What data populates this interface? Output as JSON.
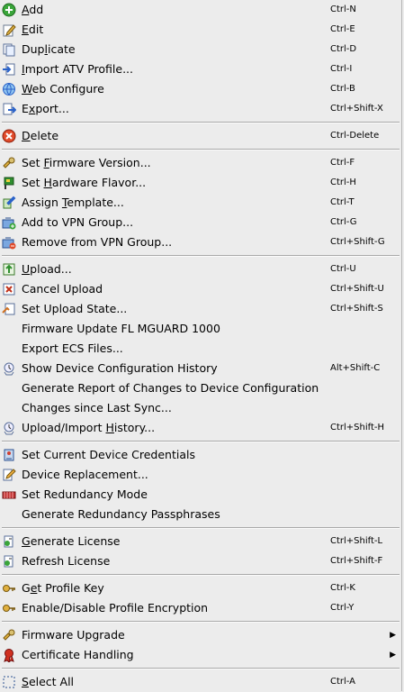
{
  "menu": {
    "groups": [
      [
        {
          "id": "add",
          "label": "Add",
          "mnemonic": 0,
          "shortcut": "Ctrl-N",
          "icon": "add-icon"
        },
        {
          "id": "edit",
          "label": "Edit",
          "mnemonic": 0,
          "shortcut": "Ctrl-E",
          "icon": "edit-icon"
        },
        {
          "id": "duplicate",
          "label": "Duplicate",
          "mnemonic": 3,
          "shortcut": "Ctrl-D",
          "icon": "duplicate-icon"
        },
        {
          "id": "import-atv-profile",
          "label": "Import ATV Profile...",
          "mnemonic": 0,
          "shortcut": "Ctrl-I",
          "icon": "import-icon"
        },
        {
          "id": "web-configure",
          "label": "Web Configure",
          "mnemonic": 0,
          "shortcut": "Ctrl-B",
          "icon": "globe-icon"
        },
        {
          "id": "export",
          "label": "Export...",
          "mnemonic": 1,
          "shortcut": "Ctrl+Shift-X",
          "icon": "export-icon"
        }
      ],
      [
        {
          "id": "delete",
          "label": "Delete",
          "mnemonic": 0,
          "shortcut": "Ctrl-Delete",
          "icon": "delete-icon"
        }
      ],
      [
        {
          "id": "set-firmware-version",
          "label": "Set Firmware Version...",
          "mnemonic": 4,
          "shortcut": "Ctrl-F",
          "icon": "firmware-icon"
        },
        {
          "id": "set-hardware-flavor",
          "label": "Set Hardware Flavor...",
          "mnemonic": 4,
          "shortcut": "Ctrl-H",
          "icon": "hardware-icon"
        },
        {
          "id": "assign-template",
          "label": "Assign Template...",
          "mnemonic": 7,
          "shortcut": "Ctrl-T",
          "icon": "template-icon"
        },
        {
          "id": "add-to-vpn-group",
          "label": "Add to VPN Group...",
          "mnemonic": -1,
          "shortcut": "Ctrl-G",
          "icon": "vpn-add-icon"
        },
        {
          "id": "remove-from-vpn-group",
          "label": "Remove from VPN Group...",
          "mnemonic": -1,
          "shortcut": "Ctrl+Shift-G",
          "icon": "vpn-remove-icon"
        }
      ],
      [
        {
          "id": "upload",
          "label": "Upload...",
          "mnemonic": 0,
          "shortcut": "Ctrl-U",
          "icon": "upload-icon"
        },
        {
          "id": "cancel-upload",
          "label": "Cancel Upload",
          "mnemonic": -1,
          "shortcut": "Ctrl+Shift-U",
          "icon": "cancel-upload-icon"
        },
        {
          "id": "set-upload-state",
          "label": "Set Upload State...",
          "mnemonic": -1,
          "shortcut": "Ctrl+Shift-S",
          "icon": "upload-state-icon"
        },
        {
          "id": "firmware-update-fl-mguard-1000",
          "label": "Firmware Update FL MGUARD 1000",
          "mnemonic": -1,
          "shortcut": "",
          "icon": ""
        },
        {
          "id": "export-ecs-files",
          "label": "Export ECS Files...",
          "mnemonic": -1,
          "shortcut": "",
          "icon": ""
        },
        {
          "id": "show-device-configuration-history",
          "label": "Show Device Configuration History",
          "mnemonic": -1,
          "shortcut": "Alt+Shift-C",
          "icon": "history-icon"
        },
        {
          "id": "generate-report-of-changes",
          "label": "Generate Report of Changes to Device Configuration",
          "mnemonic": -1,
          "shortcut": "",
          "icon": ""
        },
        {
          "id": "changes-since-last-sync",
          "label": "Changes since Last Sync...",
          "mnemonic": -1,
          "shortcut": "",
          "icon": ""
        },
        {
          "id": "upload-import-history",
          "label": "Upload/Import History...",
          "mnemonic": 14,
          "shortcut": "Ctrl+Shift-H",
          "icon": "history-icon"
        }
      ],
      [
        {
          "id": "set-current-device-credentials",
          "label": "Set Current Device Credentials",
          "mnemonic": -1,
          "shortcut": "",
          "icon": "credentials-icon"
        },
        {
          "id": "device-replacement",
          "label": "Device Replacement...",
          "mnemonic": -1,
          "shortcut": "",
          "icon": "replacement-icon"
        },
        {
          "id": "set-redundancy-mode",
          "label": "Set Redundancy Mode",
          "mnemonic": -1,
          "shortcut": "",
          "icon": "redundancy-icon"
        },
        {
          "id": "generate-redundancy-passphrases",
          "label": "Generate Redundancy Passphrases",
          "mnemonic": -1,
          "shortcut": "",
          "icon": ""
        }
      ],
      [
        {
          "id": "generate-license",
          "label": "Generate License",
          "mnemonic": 0,
          "shortcut": "Ctrl+Shift-L",
          "icon": "license-icon"
        },
        {
          "id": "refresh-license",
          "label": "Refresh License",
          "mnemonic": -1,
          "shortcut": "Ctrl+Shift-F",
          "icon": "license-icon"
        }
      ],
      [
        {
          "id": "get-profile-key",
          "label": "Get Profile Key",
          "mnemonic": 1,
          "shortcut": "Ctrl-K",
          "icon": "key-icon"
        },
        {
          "id": "enable-disable-profile-encryption",
          "label": "Enable/Disable Profile Encryption",
          "mnemonic": -1,
          "shortcut": "Ctrl-Y",
          "icon": "key-icon"
        }
      ],
      [
        {
          "id": "firmware-upgrade",
          "label": "Firmware Upgrade",
          "mnemonic": -1,
          "shortcut": "",
          "icon": "firmware-icon",
          "submenu": true
        },
        {
          "id": "certificate-handling",
          "label": "Certificate Handling",
          "mnemonic": -1,
          "shortcut": "",
          "icon": "certificate-icon",
          "submenu": true
        }
      ],
      [
        {
          "id": "select-all",
          "label": "Select All",
          "mnemonic": 0,
          "shortcut": "Ctrl-A",
          "icon": "select-all-icon"
        }
      ]
    ]
  }
}
